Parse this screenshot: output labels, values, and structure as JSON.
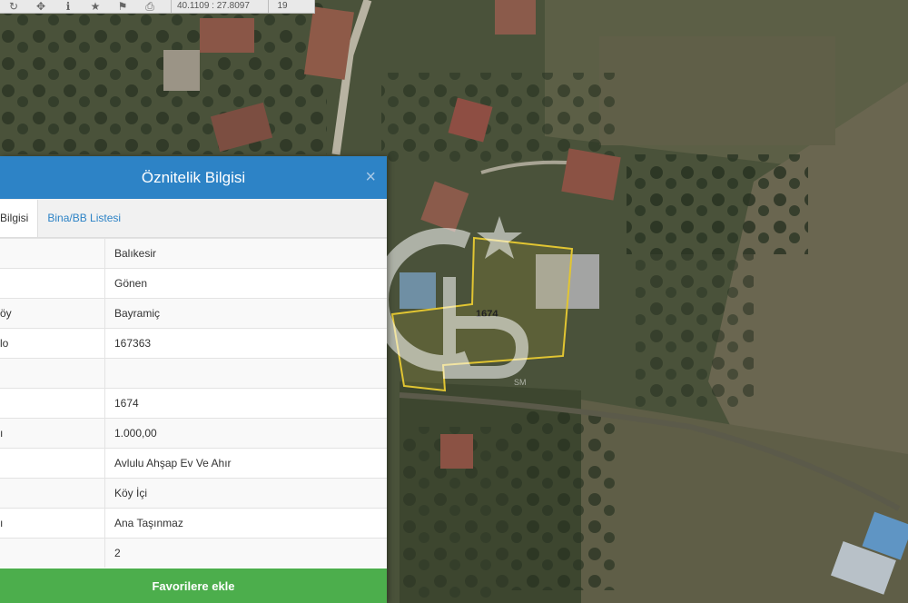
{
  "toolbar": {
    "icons": [
      "redo-icon",
      "move-icon",
      "info-icon",
      "star-icon",
      "bookmark-icon",
      "print-icon"
    ],
    "coordinates": "40.1109 : 27.8097",
    "zoom": "19"
  },
  "map": {
    "parcel_label": "1674",
    "watermark_letters": "CB",
    "watermark_mark": "SM",
    "parcel_outline_color": "#e1c532"
  },
  "dialog": {
    "title": "Öznitelik Bilgisi",
    "close_symbol": "×",
    "tabs": [
      {
        "label": "Bilgisi"
      },
      {
        "label": "Bina/BB Listesi"
      }
    ],
    "rows": [
      {
        "key": "",
        "value": "Balıkesir"
      },
      {
        "key": "",
        "value": "Gönen"
      },
      {
        "key": "öy",
        "value": "Bayramiç"
      },
      {
        "key": "lo",
        "value": "167363"
      },
      {
        "key": "",
        "value": ""
      },
      {
        "key": "",
        "value": "1674"
      },
      {
        "key": "ı",
        "value": "1.000,00"
      },
      {
        "key": "",
        "value": "Avlulu Ahşap Ev Ve Ahır"
      },
      {
        "key": "",
        "value": "Köy İçi"
      },
      {
        "key": "ı",
        "value": "Ana Taşınmaz"
      },
      {
        "key": "",
        "value": "2"
      }
    ],
    "favorite_button": "Favorilere ekle"
  },
  "colors": {
    "header": "#2d83c6",
    "button": "#4cae4c"
  }
}
